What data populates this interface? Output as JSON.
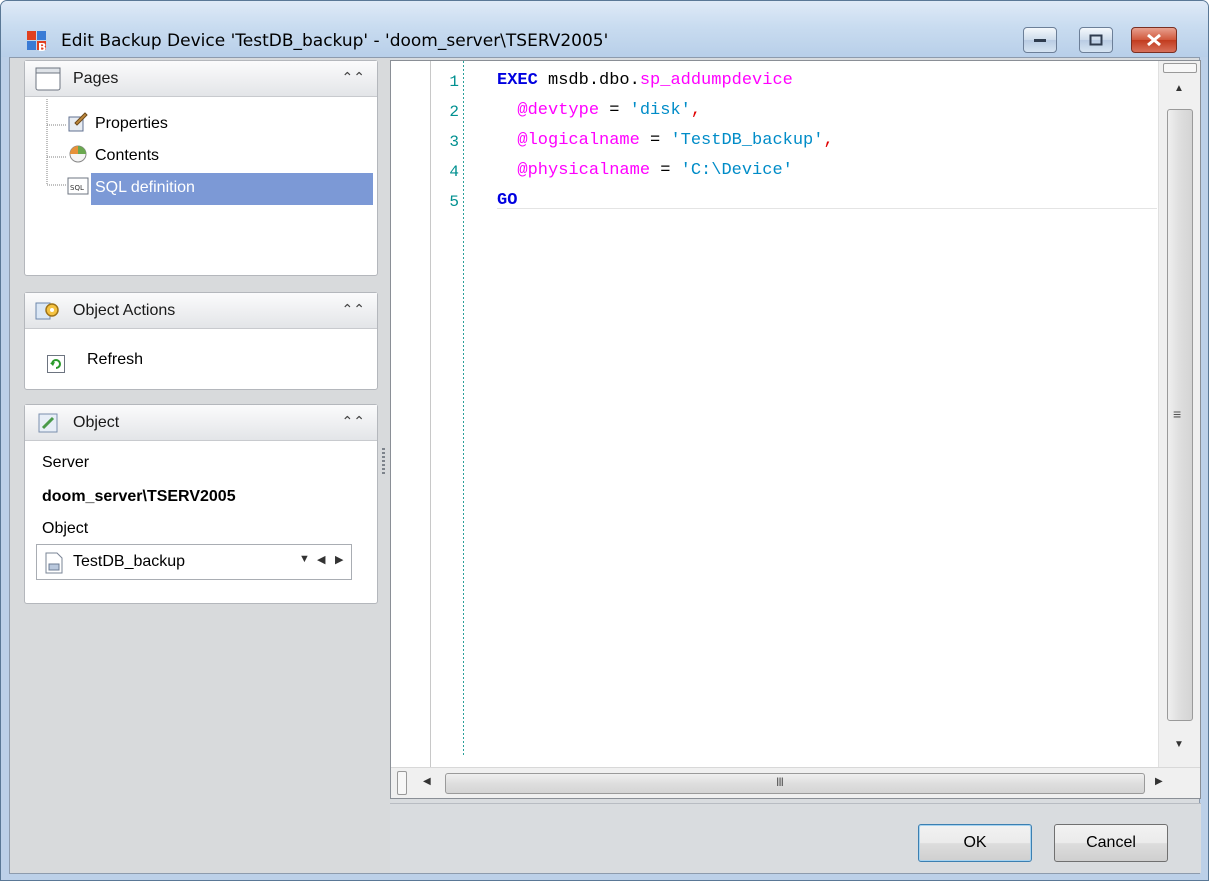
{
  "window": {
    "title": "Edit Backup Device 'TestDB_backup' - 'doom_server\\TSERV2005'"
  },
  "pages_panel": {
    "title": "Pages",
    "items": [
      {
        "label": "Properties",
        "icon": "properties-icon",
        "selected": false
      },
      {
        "label": "Contents",
        "icon": "contents-icon",
        "selected": false
      },
      {
        "label": "SQL definition",
        "icon": "sql-icon",
        "selected": true
      }
    ]
  },
  "actions_panel": {
    "title": "Object Actions",
    "refresh_label": "Refresh"
  },
  "object_panel": {
    "title": "Object",
    "server_label": "Server",
    "server_value": "doom_server\\TSERV2005",
    "object_label": "Object",
    "object_value": "TestDB_backup"
  },
  "editor": {
    "line_numbers": [
      "1",
      "2",
      "3",
      "4",
      "5"
    ],
    "lines": [
      [
        [
          "kw",
          "EXEC"
        ],
        [
          "ident",
          " msdb.dbo."
        ],
        [
          "fn",
          "sp_addumpdevice"
        ]
      ],
      [
        [
          "param",
          "  @devtype"
        ],
        [
          "punct",
          " = "
        ],
        [
          "str",
          "'disk'"
        ],
        [
          "comma",
          ","
        ]
      ],
      [
        [
          "param",
          "  @logicalname"
        ],
        [
          "punct",
          " = "
        ],
        [
          "str",
          "'TestDB_backup'"
        ],
        [
          "comma",
          ","
        ]
      ],
      [
        [
          "param",
          "  @physicalname"
        ],
        [
          "punct",
          " = "
        ],
        [
          "str",
          "'C:\\Device'"
        ]
      ],
      [
        [
          "kw",
          "GO"
        ]
      ]
    ]
  },
  "scrollbars": {
    "h_thumb_grip": "III",
    "v_thumb_grip": "≡"
  },
  "buttons": {
    "ok_label": "OK",
    "cancel_label": "Cancel"
  },
  "colors": {
    "selection": "#7c99d6",
    "keyword": "#0000e0",
    "string": "#008cc8",
    "param": "#ff00ff",
    "line_number": "#009090"
  }
}
